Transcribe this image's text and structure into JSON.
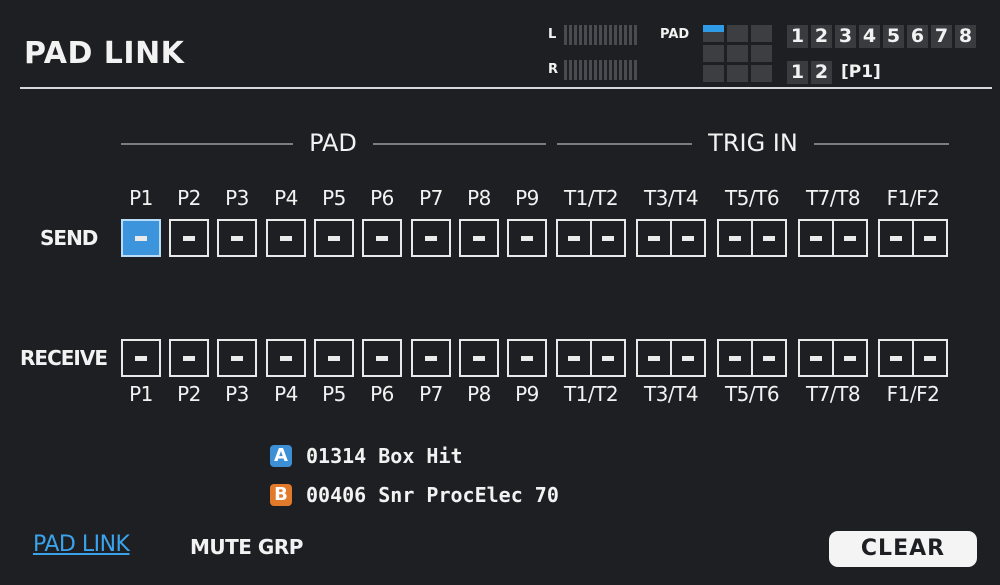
{
  "header": {
    "title": "PAD LINK",
    "meter_l": "L",
    "meter_r": "R",
    "pad_label": "PAD",
    "banks_top": [
      "1",
      "2",
      "3",
      "4",
      "5",
      "6",
      "7",
      "8"
    ],
    "banks_bottom": [
      "1",
      "2"
    ],
    "bank_pad": "[P1]"
  },
  "sections": {
    "pad": "PAD",
    "trig_in": "TRIG IN"
  },
  "rows": {
    "send": "SEND",
    "receive": "RECEIVE"
  },
  "columns": [
    "P1",
    "P2",
    "P3",
    "P4",
    "P5",
    "P6",
    "P7",
    "P8",
    "P9",
    "T1/T2",
    "T3/T4",
    "T5/T6",
    "T7/T8",
    "F1/F2"
  ],
  "instruments": [
    {
      "badge": "A",
      "text": "01314 Box Hit",
      "color": "#3d8fd6"
    },
    {
      "badge": "B",
      "text": "00406 Snr ProcElec 70",
      "color": "#e27a2c"
    }
  ],
  "tabs": {
    "active": "PAD LINK",
    "other": "MUTE GRP"
  },
  "clear_label": "CLEAR",
  "colors": {
    "accent": "#3c94dc",
    "background": "#1e1f22"
  }
}
